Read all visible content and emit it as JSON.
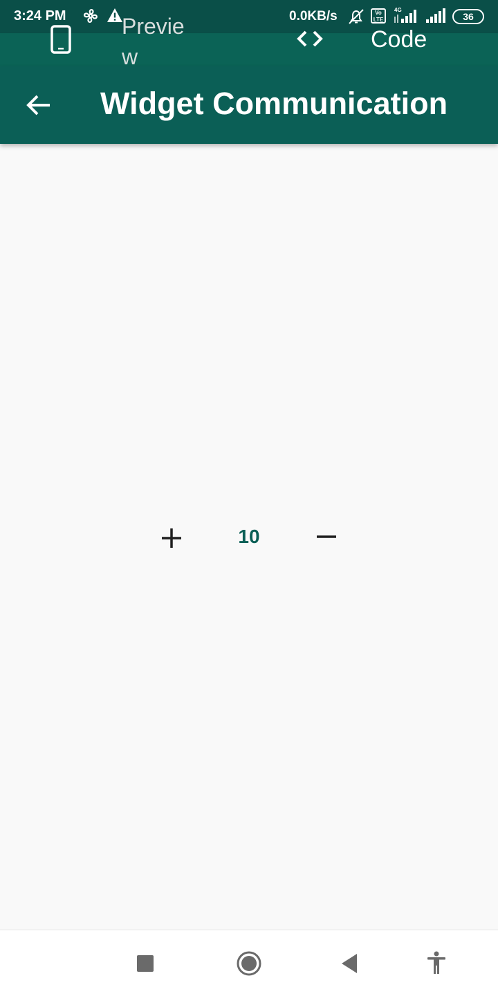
{
  "status_bar": {
    "time": "3:24 PM",
    "net_speed": "0.0KB/s",
    "volte": "Vo LTE",
    "network_type": "4G",
    "battery": "36",
    "icons": [
      "fan-icon",
      "warning-icon",
      "bell-off-icon",
      "volte-icon",
      "signal-icon",
      "signal-icon",
      "battery-icon"
    ]
  },
  "tab_bar": {
    "preview_label": "Preview",
    "code_label": "Code",
    "icons": [
      "phone-icon",
      "code-icon"
    ]
  },
  "app_bar": {
    "title": "Widget Communication",
    "icons": [
      "back-arrow-icon"
    ]
  },
  "counter": {
    "value": "10",
    "icons": [
      "plus-icon",
      "minus-icon"
    ]
  },
  "nav_bar": {
    "icons": [
      "recents-icon",
      "home-icon",
      "back-icon",
      "accessibility-icon"
    ]
  },
  "colors": {
    "status_bar": "#0a4f48",
    "tab_bar": "#0b6356",
    "app_bar": "#0b5f56",
    "accent": "#0b5f56",
    "background": "#f9f9f9"
  }
}
